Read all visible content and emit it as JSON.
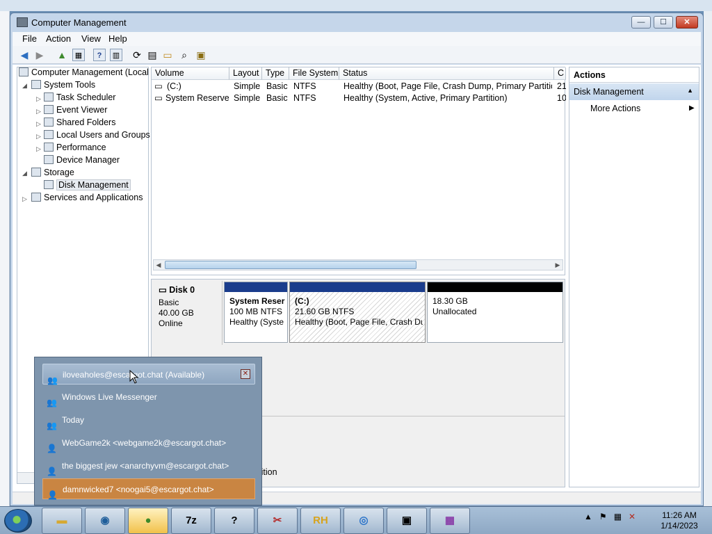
{
  "window": {
    "title": "Computer Management",
    "min": "—",
    "max": "☐",
    "close": "✕"
  },
  "menu": [
    "File",
    "Action",
    "View",
    "Help"
  ],
  "tree": {
    "root": "Computer Management (Local",
    "system_tools": "System Tools",
    "task_scheduler": "Task Scheduler",
    "event_viewer": "Event Viewer",
    "shared_folders": "Shared Folders",
    "local_users": "Local Users and Groups",
    "performance": "Performance",
    "device_manager": "Device Manager",
    "storage": "Storage",
    "disk_management": "Disk Management",
    "services": "Services and Applications"
  },
  "volumes": {
    "columns": [
      "Volume",
      "Layout",
      "Type",
      "File System",
      "Status",
      "C"
    ],
    "rows": [
      [
        "(C:)",
        "Simple",
        "Basic",
        "NTFS",
        "Healthy (Boot, Page File, Crash Dump, Primary Partition)",
        "21"
      ],
      [
        "System Reserved",
        "Simple",
        "Basic",
        "NTFS",
        "Healthy (System, Active, Primary Partition)",
        "10"
      ]
    ]
  },
  "disk": {
    "name": "Disk 0",
    "type": "Basic",
    "size": "40.00 GB",
    "state": "Online",
    "partitions": [
      {
        "title": "System Reser",
        "line1": "100 MB NTFS",
        "line2": "Healthy (Syste"
      },
      {
        "title": "(C:)",
        "line1": "21.60 GB NTFS",
        "line2": "Healthy (Boot, Page File, Crash Dur"
      },
      {
        "title": "",
        "line1": "18.30 GB",
        "line2": "Unallocated"
      }
    ],
    "legend": "rtition"
  },
  "actions": {
    "header": "Actions",
    "section": "Disk Management",
    "more": "More Actions"
  },
  "jumplist": [
    "iloveaholes@escargot.chat (Available)",
    "Windows Live Messenger",
    "Today",
    "WebGame2k <webgame2k@escargot.chat>",
    "the biggest jew <anarchyvm@escargot.chat>",
    "damnwicked7 <noogai5@escargot.chat>"
  ],
  "taskbar": {
    "apps": [
      "",
      "",
      "",
      "7z",
      "?",
      "",
      "RH",
      "",
      "",
      ""
    ]
  },
  "clock": {
    "time": "11:26 AM",
    "date": "1/14/2023"
  },
  "colors": {
    "accent": "#1a3c8c",
    "unallocated": "#000000",
    "active_item": "#c98542"
  }
}
